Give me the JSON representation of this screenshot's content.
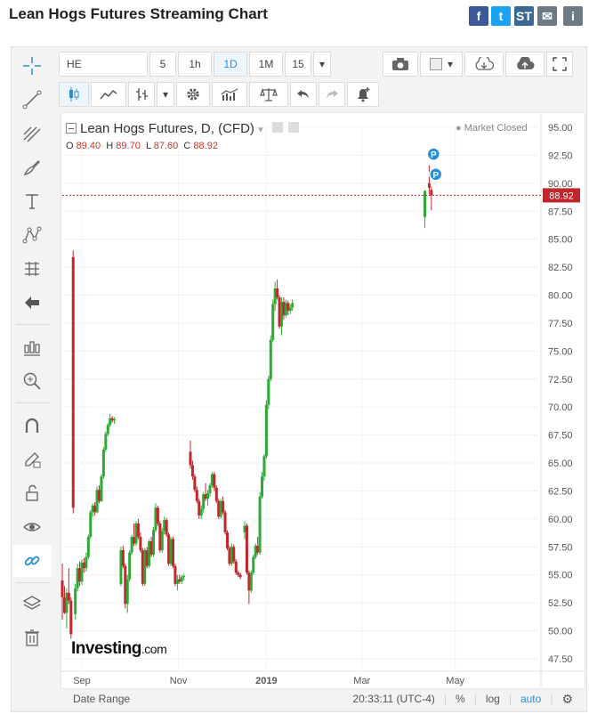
{
  "page": {
    "title": "Lean Hogs Futures Streaming Chart"
  },
  "share": [
    {
      "name": "facebook",
      "glyph": "f",
      "color": "#3b5998"
    },
    {
      "name": "twitter",
      "glyph": "t",
      "color": "#1da1f2"
    },
    {
      "name": "stocktwits",
      "glyph": "ST",
      "color": "#3a6a94"
    },
    {
      "name": "email",
      "glyph": "✉",
      "color": "#6d7a86"
    },
    {
      "name": "info",
      "glyph": "i",
      "color": "#6d7a86"
    }
  ],
  "toolbar": {
    "symbol": "HE",
    "intervals": [
      "5",
      "1h",
      "1D",
      "1M",
      "15"
    ],
    "selected_interval": "1D"
  },
  "chart_header": {
    "name": "Lean Hogs Futures, D, (CFD)",
    "market_status": "Market Closed",
    "ohlc": {
      "o_label": "O",
      "o": "89.40",
      "h_label": "H",
      "h": "89.70",
      "l_label": "L",
      "l": "87.60",
      "c_label": "C",
      "c": "88.92"
    }
  },
  "logo": {
    "main": "Investing",
    "suffix": ".com"
  },
  "status": {
    "date_range": "Date Range",
    "time": "20:33:11 (UTC-4)",
    "percent": "%",
    "log": "log",
    "auto": "auto"
  },
  "chart_data": {
    "type": "candlestick",
    "ylim": [
      46.5,
      96
    ],
    "y_ticks": [
      47.5,
      50,
      52.5,
      55,
      57.5,
      60,
      62.5,
      65,
      67.5,
      70,
      72.5,
      75,
      77.5,
      80,
      82.5,
      85,
      87.5,
      90,
      92.5,
      95
    ],
    "x_ticks": [
      {
        "label": "Sep",
        "x": 0
      },
      {
        "label": "Nov",
        "x": 44.5
      },
      {
        "label": "2019",
        "x": 85
      },
      {
        "label": "Mar",
        "x": 129
      },
      {
        "label": "May",
        "x": 172
      }
    ],
    "last_price": 88.92,
    "last_price_label": "88.92",
    "colors": {
      "up": "#2ea836",
      "down": "#c0272d",
      "price_line": "#c0272d"
    },
    "event_markers": [
      {
        "label": "P",
        "x": 162,
        "y": 92.6
      },
      {
        "label": "P",
        "x": 163,
        "y": 90.8
      }
    ],
    "candles": [
      {
        "x": -9,
        "o": 54.5,
        "h": 56,
        "l": 51,
        "c": 53
      },
      {
        "x": -8,
        "o": 53,
        "h": 54,
        "l": 51.5,
        "c": 51.6
      },
      {
        "x": -7,
        "o": 51.6,
        "h": 53.8,
        "l": 50.2,
        "c": 53.4
      },
      {
        "x": -6,
        "o": 53.4,
        "h": 55.6,
        "l": 52.4,
        "c": 52.7
      },
      {
        "x": -5,
        "o": 52.7,
        "h": 53,
        "l": 49.3,
        "c": 49.7
      },
      {
        "x": -4,
        "o": 83.4,
        "h": 84,
        "l": 60.5,
        "c": 61.0
      },
      {
        "x": -3,
        "o": 51.5,
        "h": 54.2,
        "l": 51,
        "c": 53.8
      },
      {
        "x": -2,
        "o": 53.8,
        "h": 56,
        "l": 53.5,
        "c": 55.6
      },
      {
        "x": -1,
        "o": 55.6,
        "h": 56.2,
        "l": 54,
        "c": 54.4
      },
      {
        "x": 0,
        "o": 54.4,
        "h": 56.4,
        "l": 54.1,
        "c": 56.1
      },
      {
        "x": 1,
        "o": 56.1,
        "h": 56.5,
        "l": 55.2,
        "c": 55.6
      },
      {
        "x": 2,
        "o": 55.6,
        "h": 57,
        "l": 55.3,
        "c": 56.6
      },
      {
        "x": 3,
        "o": 56.6,
        "h": 58.6,
        "l": 56.4,
        "c": 58.4
      },
      {
        "x": 4,
        "o": 58.4,
        "h": 60.8,
        "l": 58.2,
        "c": 60.6
      },
      {
        "x": 5,
        "o": 60.6,
        "h": 61.4,
        "l": 60.2,
        "c": 61.2
      },
      {
        "x": 6,
        "o": 61.2,
        "h": 61.5,
        "l": 60.3,
        "c": 60.6
      },
      {
        "x": 7,
        "o": 60.6,
        "h": 62.9,
        "l": 60.5,
        "c": 62.6
      },
      {
        "x": 8,
        "o": 62.6,
        "h": 63,
        "l": 61.4,
        "c": 61.6
      },
      {
        "x": 9,
        "o": 61.6,
        "h": 64,
        "l": 61.5,
        "c": 63.8
      },
      {
        "x": 10,
        "o": 63.8,
        "h": 66.4,
        "l": 63.6,
        "c": 66.2
      },
      {
        "x": 11,
        "o": 66.2,
        "h": 67.8,
        "l": 66,
        "c": 67.6
      },
      {
        "x": 12,
        "o": 67.6,
        "h": 68.6,
        "l": 67.4,
        "c": 68.4
      },
      {
        "x": 13,
        "o": 68.4,
        "h": 69.4,
        "l": 68.2,
        "c": 69.0
      },
      {
        "x": 14,
        "o": 69.0,
        "h": 69.2,
        "l": 68.6,
        "c": 68.8
      },
      {
        "x": 15,
        "o": 68.8,
        "h": 69.1,
        "l": 68.5,
        "c": 68.9
      },
      {
        "x": 18,
        "o": 54.2,
        "h": 57.5,
        "l": 54.0,
        "c": 57.2
      },
      {
        "x": 19,
        "o": 57.2,
        "h": 57.6,
        "l": 55.6,
        "c": 55.8
      },
      {
        "x": 20,
        "o": 55.8,
        "h": 56,
        "l": 52,
        "c": 52.4
      },
      {
        "x": 21,
        "o": 52.4,
        "h": 55,
        "l": 51.6,
        "c": 54.6
      },
      {
        "x": 22,
        "o": 54.6,
        "h": 57.2,
        "l": 54.4,
        "c": 57.0
      },
      {
        "x": 23,
        "o": 57.0,
        "h": 58.6,
        "l": 56.8,
        "c": 58.4
      },
      {
        "x": 24,
        "o": 58.4,
        "h": 59.6,
        "l": 57.6,
        "c": 57.8
      },
      {
        "x": 25,
        "o": 57.8,
        "h": 59.8,
        "l": 57.6,
        "c": 59.6
      },
      {
        "x": 26,
        "o": 59.6,
        "h": 60,
        "l": 58.2,
        "c": 58.4
      },
      {
        "x": 27,
        "o": 58.4,
        "h": 58.8,
        "l": 57.0,
        "c": 57.2
      },
      {
        "x": 28,
        "o": 57.2,
        "h": 57.4,
        "l": 54.0,
        "c": 54.2
      },
      {
        "x": 29,
        "o": 54.2,
        "h": 57.4,
        "l": 54.0,
        "c": 57.2
      },
      {
        "x": 30,
        "o": 57.2,
        "h": 57.5,
        "l": 55.6,
        "c": 55.8
      },
      {
        "x": 31,
        "o": 55.8,
        "h": 58.2,
        "l": 55.6,
        "c": 58.0
      },
      {
        "x": 32,
        "o": 58.0,
        "h": 58.4,
        "l": 56.6,
        "c": 56.8
      },
      {
        "x": 33,
        "o": 56.8,
        "h": 59.3,
        "l": 56.6,
        "c": 59.0
      },
      {
        "x": 34,
        "o": 59.0,
        "h": 61.4,
        "l": 58.8,
        "c": 61.0
      },
      {
        "x": 35,
        "o": 61.0,
        "h": 61.2,
        "l": 59.4,
        "c": 59.6
      },
      {
        "x": 36,
        "o": 59.6,
        "h": 59.8,
        "l": 57.0,
        "c": 57.2
      },
      {
        "x": 37,
        "o": 57.2,
        "h": 59.2,
        "l": 57.0,
        "c": 58.9
      },
      {
        "x": 38,
        "o": 58.9,
        "h": 60.2,
        "l": 58.6,
        "c": 59.9
      },
      {
        "x": 39,
        "o": 59.9,
        "h": 60.1,
        "l": 58.4,
        "c": 58.6
      },
      {
        "x": 40,
        "o": 58.6,
        "h": 58.8,
        "l": 55.8,
        "c": 56.0
      },
      {
        "x": 41,
        "o": 56.0,
        "h": 58.4,
        "l": 55.8,
        "c": 58.2
      },
      {
        "x": 42,
        "o": 58.2,
        "h": 58.4,
        "l": 55.6,
        "c": 55.8
      },
      {
        "x": 43,
        "o": 55.8,
        "h": 56,
        "l": 54.0,
        "c": 54.2
      },
      {
        "x": 44,
        "o": 54.2,
        "h": 55,
        "l": 53.6,
        "c": 54.6
      },
      {
        "x": 45,
        "o": 54.6,
        "h": 55,
        "l": 54.2,
        "c": 54.4
      },
      {
        "x": 46,
        "o": 54.4,
        "h": 55,
        "l": 54.2,
        "c": 54.8
      },
      {
        "x": 47,
        "o": 54.8,
        "h": 55.1,
        "l": 54.5,
        "c": 54.9
      },
      {
        "x": 50,
        "o": 66.0,
        "h": 67.0,
        "l": 64.5,
        "c": 64.8
      },
      {
        "x": 51,
        "o": 64.8,
        "h": 65.2,
        "l": 63.5,
        "c": 63.8
      },
      {
        "x": 52,
        "o": 63.8,
        "h": 64.0,
        "l": 62.4,
        "c": 62.6
      },
      {
        "x": 53,
        "o": 62.6,
        "h": 62.9,
        "l": 61.4,
        "c": 61.6
      },
      {
        "x": 54,
        "o": 61.6,
        "h": 61.8,
        "l": 60.0,
        "c": 60.3
      },
      {
        "x": 55,
        "o": 60.3,
        "h": 61.2,
        "l": 60.0,
        "c": 60.9
      },
      {
        "x": 56,
        "o": 60.9,
        "h": 62.4,
        "l": 60.6,
        "c": 62.2
      },
      {
        "x": 57,
        "o": 62.2,
        "h": 63.2,
        "l": 61.6,
        "c": 61.8
      },
      {
        "x": 58,
        "o": 61.8,
        "h": 62.6,
        "l": 61.2,
        "c": 62.3
      },
      {
        "x": 59,
        "o": 62.3,
        "h": 63.2,
        "l": 62.0,
        "c": 63.0
      },
      {
        "x": 60,
        "o": 63.0,
        "h": 64.2,
        "l": 62.8,
        "c": 64.0
      },
      {
        "x": 61,
        "o": 64.0,
        "h": 64.2,
        "l": 62.5,
        "c": 62.8
      },
      {
        "x": 62,
        "o": 62.8,
        "h": 63.0,
        "l": 61.4,
        "c": 61.6
      },
      {
        "x": 63,
        "o": 61.6,
        "h": 61.8,
        "l": 60.0,
        "c": 60.2
      },
      {
        "x": 64,
        "o": 60.2,
        "h": 61.8,
        "l": 60.0,
        "c": 61.6
      },
      {
        "x": 65,
        "o": 61.6,
        "h": 62.0,
        "l": 60.4,
        "c": 60.6
      },
      {
        "x": 66,
        "o": 60.6,
        "h": 60.8,
        "l": 58.6,
        "c": 58.8
      },
      {
        "x": 67,
        "o": 58.8,
        "h": 59.0,
        "l": 57.2,
        "c": 57.4
      },
      {
        "x": 68,
        "o": 57.4,
        "h": 57.6,
        "l": 55.8,
        "c": 56.0
      },
      {
        "x": 69,
        "o": 56.0,
        "h": 57.8,
        "l": 55.8,
        "c": 57.5
      },
      {
        "x": 70,
        "o": 57.5,
        "h": 57.7,
        "l": 56.0,
        "c": 56.2
      },
      {
        "x": 71,
        "o": 56.2,
        "h": 56.4,
        "l": 55.0,
        "c": 55.2
      },
      {
        "x": 72,
        "o": 55.2,
        "h": 55.4,
        "l": 54.8,
        "c": 55.0
      },
      {
        "x": 73,
        "o": 55.0,
        "h": 55.2,
        "l": 54.6,
        "c": 54.8
      },
      {
        "x": 75,
        "o": 58.8,
        "h": 59.8,
        "l": 58.2,
        "c": 59.4
      },
      {
        "x": 76,
        "o": 59.4,
        "h": 59.6,
        "l": 55.0,
        "c": 55.2
      },
      {
        "x": 77,
        "o": 55.2,
        "h": 55.4,
        "l": 52.4,
        "c": 53.6
      },
      {
        "x": 78,
        "o": 53.6,
        "h": 55.4,
        "l": 53.4,
        "c": 55.2
      },
      {
        "x": 79,
        "o": 55.2,
        "h": 56.8,
        "l": 55.0,
        "c": 56.6
      },
      {
        "x": 80,
        "o": 56.6,
        "h": 57.8,
        "l": 56.4,
        "c": 57.6
      },
      {
        "x": 81,
        "o": 57.6,
        "h": 58.4,
        "l": 56.8,
        "c": 57.0
      },
      {
        "x": 82,
        "o": 57.0,
        "h": 62.4,
        "l": 56.8,
        "c": 62.0
      },
      {
        "x": 83,
        "o": 62.0,
        "h": 64.2,
        "l": 61.8,
        "c": 63.8
      },
      {
        "x": 84,
        "o": 63.8,
        "h": 65.8,
        "l": 63.4,
        "c": 65.6
      },
      {
        "x": 85,
        "o": 65.6,
        "h": 70.6,
        "l": 65.4,
        "c": 70.2
      },
      {
        "x": 86,
        "o": 70.2,
        "h": 72.8,
        "l": 69.8,
        "c": 72.5
      },
      {
        "x": 87,
        "o": 72.5,
        "h": 76.4,
        "l": 72.3,
        "c": 76.0
      },
      {
        "x": 88,
        "o": 76.0,
        "h": 79.6,
        "l": 75.8,
        "c": 79.2
      },
      {
        "x": 89,
        "o": 79.2,
        "h": 81.2,
        "l": 78.6,
        "c": 80.6
      },
      {
        "x": 90,
        "o": 80.6,
        "h": 81.4,
        "l": 79.6,
        "c": 79.8
      },
      {
        "x": 91,
        "o": 79.8,
        "h": 80.0,
        "l": 77.0,
        "c": 77.2
      },
      {
        "x": 92,
        "o": 77.2,
        "h": 79.8,
        "l": 76.4,
        "c": 79.4
      },
      {
        "x": 93,
        "o": 79.4,
        "h": 79.8,
        "l": 77.8,
        "c": 78.2
      },
      {
        "x": 94,
        "o": 78.2,
        "h": 79.6,
        "l": 78.0,
        "c": 79.3
      },
      {
        "x": 95,
        "o": 79.3,
        "h": 79.5,
        "l": 78.2,
        "c": 78.6
      },
      {
        "x": 96,
        "o": 78.6,
        "h": 79.2,
        "l": 78.3,
        "c": 78.9
      },
      {
        "x": 97,
        "o": 78.9,
        "h": 79.6,
        "l": 78.6,
        "c": 79.3
      },
      {
        "x": 158,
        "o": 87.0,
        "h": 89.4,
        "l": 86.0,
        "c": 89.3
      },
      {
        "x": 160,
        "o": 90.0,
        "h": 91.6,
        "l": 89.0,
        "c": 89.6
      },
      {
        "x": 161,
        "o": 89.4,
        "h": 89.7,
        "l": 87.6,
        "c": 88.92
      }
    ]
  }
}
